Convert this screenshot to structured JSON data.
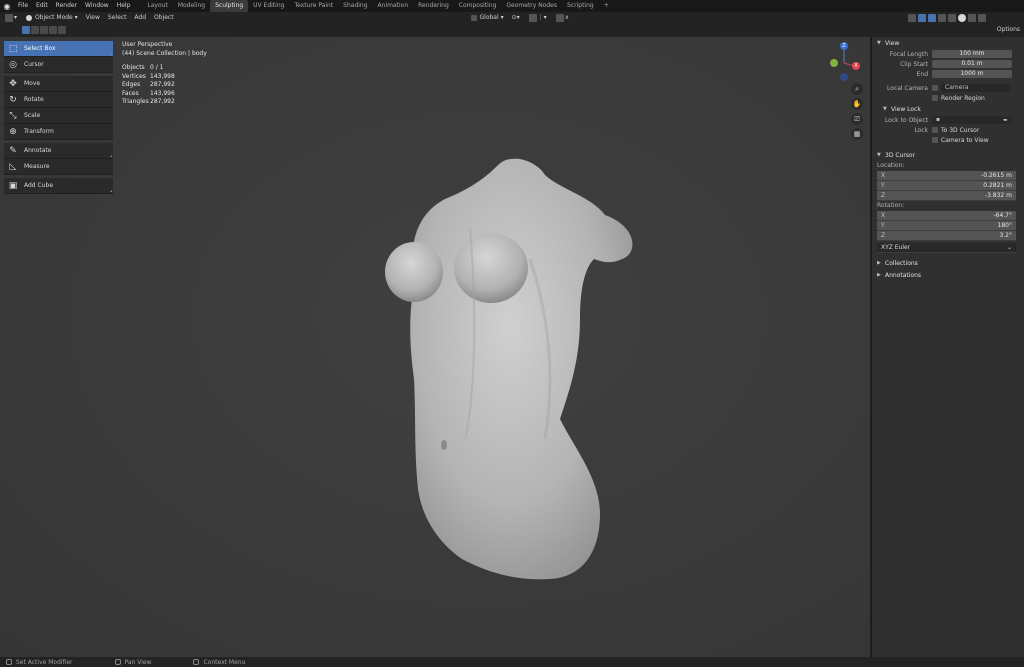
{
  "topbar": {
    "menu": [
      "File",
      "Edit",
      "Render",
      "Window",
      "Help"
    ],
    "tabs": [
      "Layout",
      "Modeling",
      "Sculpting",
      "UV Editing",
      "Texture Paint",
      "Shading",
      "Animation",
      "Rendering",
      "Compositing",
      "Geometry Nodes",
      "Scripting",
      "+"
    ],
    "active_tab": "Sculpting"
  },
  "header": {
    "mode": "Object Mode",
    "menus": [
      "View",
      "Select",
      "Add",
      "Object"
    ],
    "transform_orientation": "Global",
    "options": "Options"
  },
  "toolbar": {
    "tools": [
      {
        "label": "Select Box",
        "icon": "select-box-icon",
        "selected": true
      },
      {
        "label": "Cursor",
        "icon": "cursor-icon"
      },
      {
        "label": "Move",
        "icon": "move-icon"
      },
      {
        "label": "Rotate",
        "icon": "rotate-icon"
      },
      {
        "label": "Scale",
        "icon": "scale-icon"
      },
      {
        "label": "Transform",
        "icon": "transform-icon"
      },
      {
        "label": "Annotate",
        "icon": "annotate-icon"
      },
      {
        "label": "Measure",
        "icon": "measure-icon"
      },
      {
        "label": "Add Cube",
        "icon": "add-cube-icon"
      }
    ]
  },
  "overlay": {
    "view_name": "User Perspective",
    "collection": "(44) Scene Collection | body",
    "stats": [
      {
        "label": "Objects",
        "value": "0 / 1"
      },
      {
        "label": "Vertices",
        "value": "143,998"
      },
      {
        "label": "Edges",
        "value": "287,992"
      },
      {
        "label": "Faces",
        "value": "143,996"
      },
      {
        "label": "Triangles",
        "value": "287,992"
      }
    ]
  },
  "gizmo": {
    "z": "Z",
    "x": "X",
    "y": "Y"
  },
  "sidebar": {
    "view": {
      "title": "View",
      "focal_length_label": "Focal Length",
      "focal_length": "100 mm",
      "clip_start_label": "Clip Start",
      "clip_start": "0.01 m",
      "end_label": "End",
      "end": "1000 m",
      "local_camera_label": "Local Camera",
      "local_camera": "Camera",
      "render_region": "Render Region"
    },
    "view_lock": {
      "title": "View Lock",
      "lock_to_object_label": "Lock to Object",
      "lock_label": "Lock",
      "to_3d_cursor": "To 3D Cursor",
      "camera_to_view": "Camera to View"
    },
    "cursor": {
      "title": "3D Cursor",
      "location_label": "Location:",
      "location": [
        {
          "axis": "X",
          "value": "-0.2615 m"
        },
        {
          "axis": "Y",
          "value": "0.2821 m"
        },
        {
          "axis": "Z",
          "value": "-3.832 m"
        }
      ],
      "rotation_label": "Rotation:",
      "rotation": [
        {
          "axis": "X",
          "value": "-64.7°"
        },
        {
          "axis": "Y",
          "value": "180°"
        },
        {
          "axis": "Z",
          "value": "3.2°"
        }
      ],
      "rotation_mode": "XYZ Euler"
    },
    "collections": "Collections",
    "annotations": "Annotations"
  },
  "status": {
    "items": [
      "Set Active Modifier",
      "Pan View",
      "Context Menu"
    ]
  }
}
